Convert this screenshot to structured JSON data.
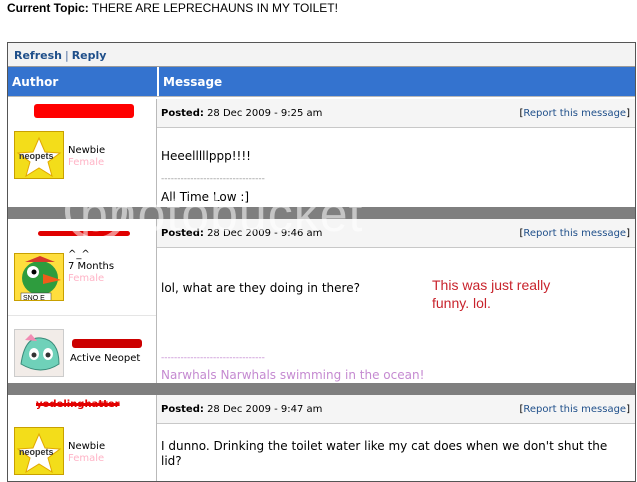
{
  "topic": {
    "label": "Current Topic:",
    "title": "THERE ARE LEPRECHAUNS IN MY TOILET!"
  },
  "toolbar": {
    "refresh": "Refresh",
    "sep": "|",
    "reply": "Reply"
  },
  "columns": {
    "author": "Author",
    "message": "Message"
  },
  "posts": [
    {
      "rank": "Newbie",
      "gender": "Female",
      "posted_label": "Posted:",
      "posted_date": "28 Dec 2009 - 9:25 am",
      "report": "Report this message",
      "body": "Heeelllllppp!!!!",
      "sig_line": "--------------------------------",
      "signature": "All Time Low :]",
      "sig_color": "#000000"
    },
    {
      "rank_prefix": "^_^",
      "rank": "7 Months",
      "gender": "Female",
      "posted_label": "Posted:",
      "posted_date": "28 Dec 2009 - 9:46 am",
      "report": "Report this message",
      "body": "lol, what are they doing in there?",
      "sig_line": "--------------------------------",
      "signature": "Narwhals Narwhals swimming in the ocean!",
      "sig_color": "#c58ad1",
      "second_rank": "Active Neopet"
    },
    {
      "username": "yodelinghatter",
      "rank": "Newbie",
      "gender": "Female",
      "posted_label": "Posted:",
      "posted_date": "28 Dec 2009 - 9:47 am",
      "report": "Report this message",
      "body": "I dunno. Drinking the toilet water like my cat does when we don't shut the lid?"
    }
  ],
  "annotation": {
    "line1": "This was just really",
    "line2": "funny. lol.",
    "color": "#c8232c"
  },
  "watermark": "photobucket",
  "colors": {
    "header_blue": "#3473cf",
    "link_blue": "#1f4f8a",
    "redact_red": "#ff0000"
  }
}
